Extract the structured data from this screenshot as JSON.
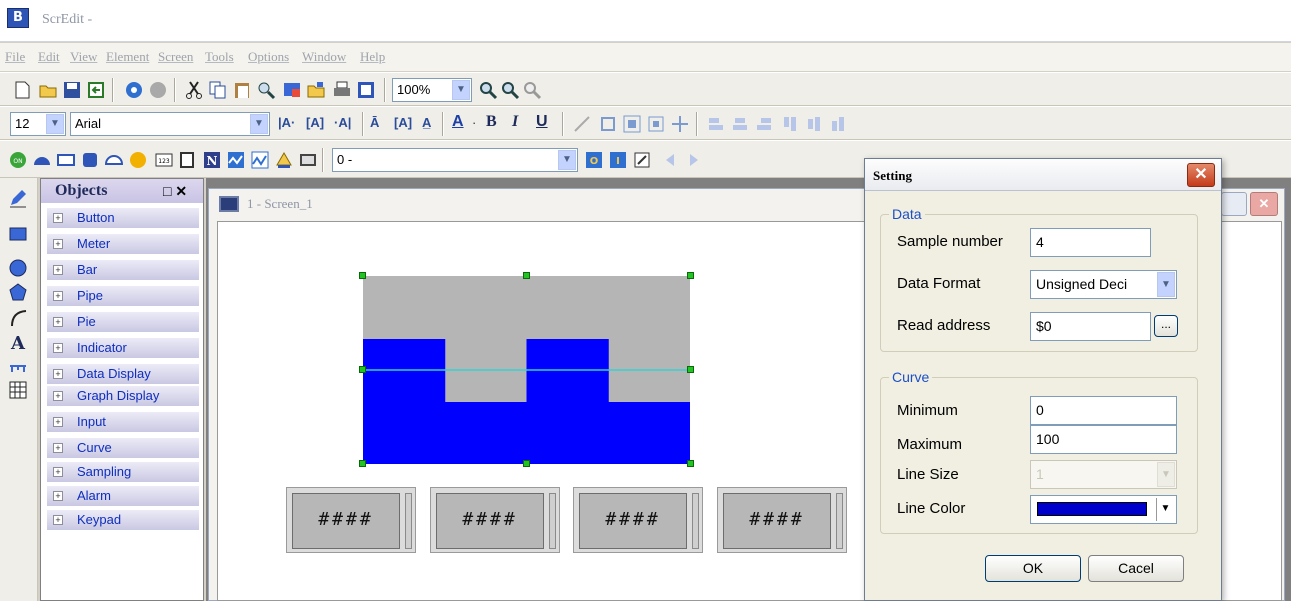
{
  "app": {
    "title": "ScrEdit -",
    "icon_letter": "B"
  },
  "menu": [
    "File",
    "Edit",
    "View",
    "Element",
    "Screen",
    "Tools",
    "Options",
    "Window",
    "Help"
  ],
  "toolbar1": {
    "zoom": "100%"
  },
  "toolbar2": {
    "font_size": "12",
    "font_name": "Arial",
    "bold": "B",
    "italic": "I",
    "underline": "U"
  },
  "toolbar3": {
    "address_combo": "0 -"
  },
  "objects_panel": {
    "title": "Objects",
    "items": [
      "Button",
      "Meter",
      "Bar",
      "Pipe",
      "Pie",
      "Indicator",
      "Data Display",
      "Graph Display",
      "Input",
      "Curve",
      "Sampling",
      "Alarm",
      "Keypad"
    ]
  },
  "screen_window": {
    "title": "1 - Screen_1"
  },
  "curve_preview": {
    "levels": [
      1,
      0,
      1,
      0
    ],
    "fill_color": "#0000ff",
    "background_color": "#b5b5b5",
    "midline_color": "#39d0d0"
  },
  "numeric_displays": [
    "####",
    "####",
    "####",
    "####"
  ],
  "dialog": {
    "title": "Setting",
    "data_group": {
      "label": "Data",
      "sample_number_label": "Sample number",
      "sample_number_value": "4",
      "data_format_label": "Data Format",
      "data_format_value": "Unsigned Deci",
      "read_address_label": "Read address",
      "read_address_value": "$0",
      "browse_button": "..."
    },
    "curve_group": {
      "label": "Curve",
      "minimum_label": "Minimum",
      "minimum_value": "0",
      "maximum_label": "Maximum",
      "maximum_value": "100",
      "line_size_label": "Line Size",
      "line_size_value": "1",
      "line_color_label": "Line Color",
      "line_color_value": "#0000cc"
    },
    "ok_button": "OK",
    "cancel_button": "Cacel"
  }
}
